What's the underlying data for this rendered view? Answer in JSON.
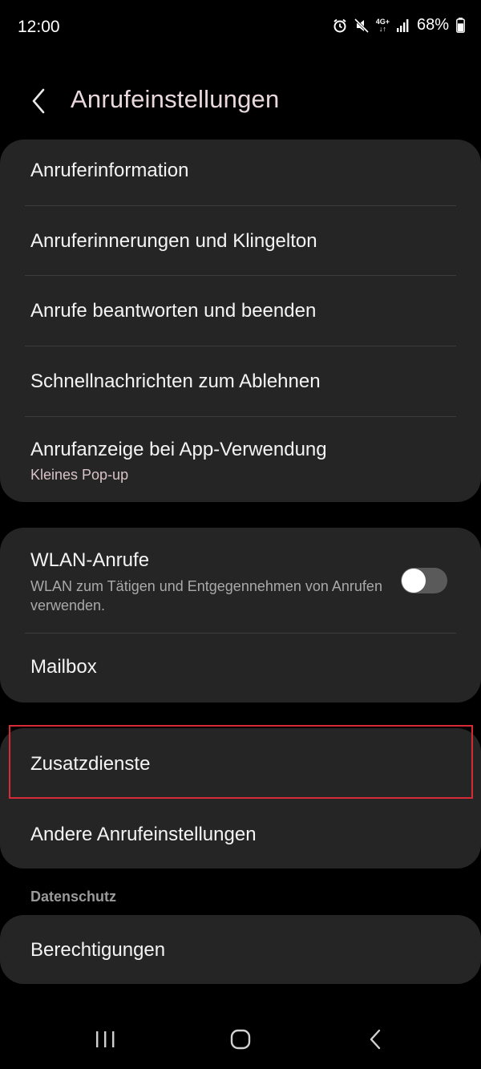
{
  "status_bar": {
    "time": "12:00",
    "network_label_top": "4G+",
    "network_label_bottom": "↓↑",
    "battery_percent": "68%",
    "battery_level": 0.68,
    "icons": [
      "alarm-icon",
      "mute-icon",
      "network-4g-icon",
      "signal-icon",
      "battery-icon"
    ]
  },
  "header": {
    "back_icon": "chevron-left-icon",
    "title": "Anrufeinstellungen"
  },
  "group1": {
    "items": [
      {
        "title": "Anruferinformation"
      },
      {
        "title": "Anruferinnerungen und Klingelton"
      },
      {
        "title": "Anrufe beantworten und beenden"
      },
      {
        "title": "Schnellnachrichten zum Ablehnen"
      },
      {
        "title": "Anrufanzeige bei App-Verwendung",
        "subtitle": "Kleines Pop-up"
      }
    ]
  },
  "group2": {
    "wlan": {
      "title": "WLAN-Anrufe",
      "description": "WLAN zum Tätigen und Entgegennehmen von Anrufen verwenden.",
      "toggle_on": false
    },
    "mailbox": {
      "title": "Mailbox"
    }
  },
  "group3": {
    "items": [
      {
        "title": "Zusatzdienste",
        "highlighted": true
      },
      {
        "title": "Andere Anrufeinstellungen"
      }
    ]
  },
  "privacy": {
    "section_label": "Datenschutz",
    "items": [
      {
        "title": "Berechtigungen"
      }
    ]
  },
  "nav_bar": {
    "icons": [
      "recent-apps-icon",
      "home-icon",
      "back-icon"
    ]
  },
  "colors": {
    "background": "#000000",
    "card": "#252525",
    "title": "#e9d8dc",
    "subtitle_accent": "#d8c3c8",
    "highlight": "#d62b36"
  }
}
